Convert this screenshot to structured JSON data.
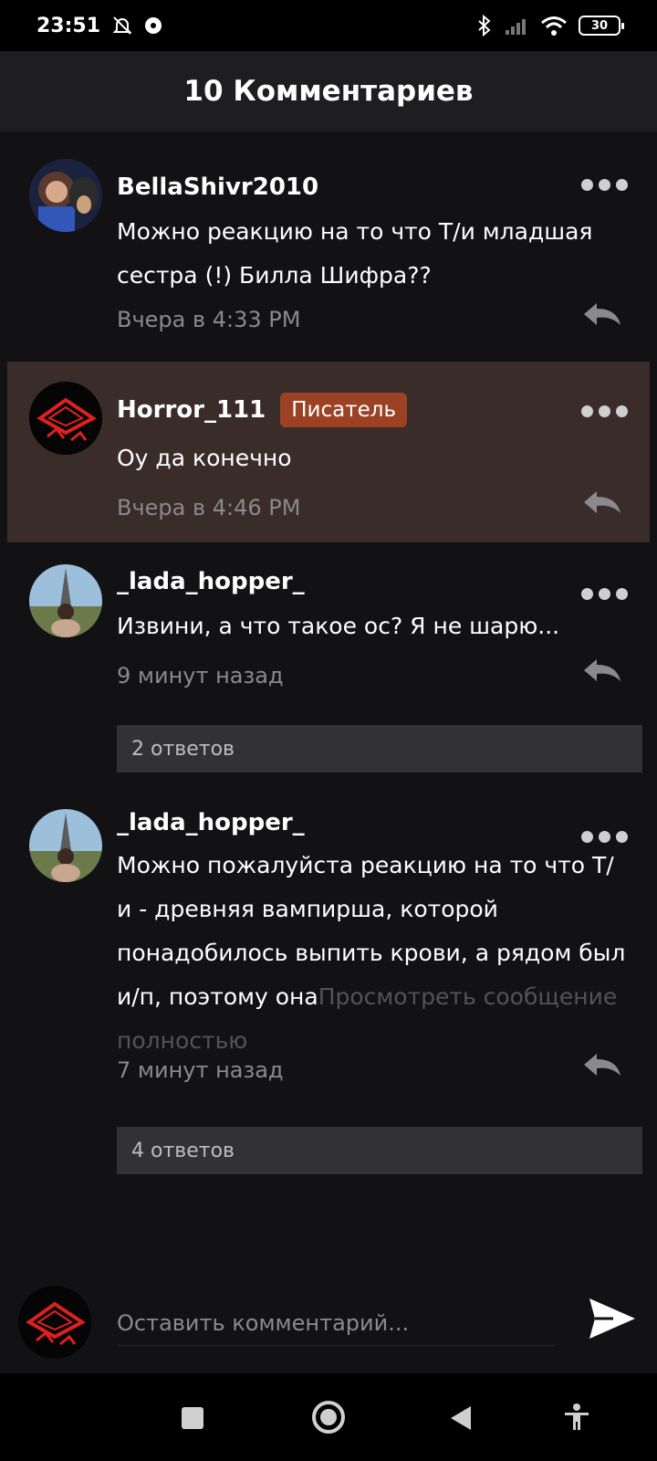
{
  "status": {
    "time": "23:51",
    "battery": "30",
    "icons": [
      "bell-off-icon",
      "cloud-icon",
      "bluetooth-icon",
      "signal-icon",
      "wifi-icon",
      "battery-icon"
    ]
  },
  "header": {
    "title": "10 Комментариев"
  },
  "comments": [
    {
      "author": "BellaShivr2010",
      "text": "Можно реакцию на то что Т/и младшая сестра (!) Билла Шифра??",
      "time": "Вчера в 4:33 PM"
    },
    {
      "author": "Horror_111",
      "badge": "Писатель",
      "text": "Оу да конечно",
      "time": "Вчера в 4:46 PM"
    },
    {
      "author": "_lada_hopper_",
      "text": "Извини, а что такое ос? Я не шарю...",
      "time": "9 минут назад",
      "replies": "2 ответов"
    },
    {
      "author": "_lada_hopper_",
      "text": "Можно пожалуйста реакцию на то что Т/и - древняя вампирша, которой понадобилось выпить крови, а рядом был и/п, поэтому она",
      "more_link": "Просмотреть сообщение полностью",
      "time": "7 минут назад",
      "replies": "4 ответов"
    }
  ],
  "input": {
    "placeholder": "Оставить комментарий..."
  },
  "colors": {
    "background": "#121113",
    "header": "#1e1d1f",
    "highlight": "#3a2c29",
    "badge": "#9c4224",
    "muted_text": "#8a898c",
    "replies_bar": "#323134"
  }
}
